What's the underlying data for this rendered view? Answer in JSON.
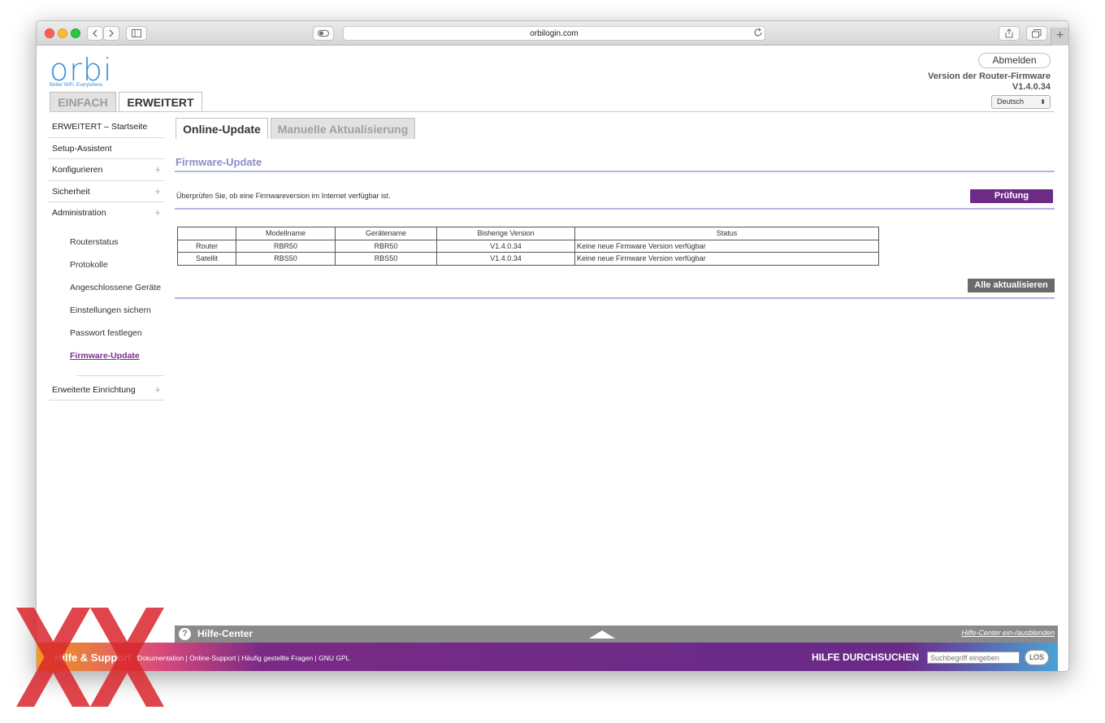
{
  "browser": {
    "url": "orbilogin.com"
  },
  "brand": {
    "logo": "orbi",
    "tagline": "Better WiFi. Everywhere."
  },
  "mode_tabs": {
    "simple": "EINFACH",
    "advanced": "ERWEITERT"
  },
  "header": {
    "logout": "Abmelden",
    "firmware_label": "Version der Router-Firmware",
    "firmware_version": "V1.4.0.34",
    "language": "Deutsch"
  },
  "sidebar": {
    "items": [
      {
        "label": "ERWEITERT – Startseite"
      },
      {
        "label": "Setup-Assistent"
      },
      {
        "label": "Konfigurieren",
        "expand": "+"
      },
      {
        "label": "Sicherheit",
        "expand": "+"
      },
      {
        "label": "Administration",
        "expand": "+"
      }
    ],
    "subitems": [
      {
        "label": "Routerstatus"
      },
      {
        "label": "Protokolle"
      },
      {
        "label": "Angeschlossene Geräte"
      },
      {
        "label": "Einstellungen sichern"
      },
      {
        "label": "Passwort festlegen"
      },
      {
        "label": "Firmware-Update"
      }
    ],
    "advanced_setup": {
      "label": "Erweiterte Einrichtung",
      "expand": "+"
    }
  },
  "content": {
    "tabs": [
      {
        "label": "Online-Update"
      },
      {
        "label": "Manuelle Aktualisierung"
      }
    ],
    "section_title": "Firmware-Update",
    "check_text": "Überprüfen Sie, ob eine Firmwareversion im Internet verfügbar ist.",
    "check_button": "Prüfung",
    "update_all_button": "Alle aktualisieren",
    "table": {
      "headers": [
        "",
        "Modellname",
        "Gerätename",
        "Bisherige Version",
        "Status"
      ],
      "rows": [
        [
          "Router",
          "RBR50",
          "RBR50",
          "V1.4.0.34",
          "Keine neue Firmware Version verfügbar"
        ],
        [
          "Satellit",
          "RBS50",
          "RBS50",
          "V1.4.0.34",
          "Keine neue Firmware Version verfügbar"
        ]
      ]
    }
  },
  "help": {
    "icon": "?",
    "title": "Hilfe-Center",
    "toggle": "Hilfe-Center ein-/ausblenden"
  },
  "support": {
    "title": "Hilfe & Support",
    "links": [
      "Dokumentation",
      "Online-Support",
      "Häufig gestellte Fragen",
      "GNU GPL"
    ],
    "link_sep": "|",
    "search_label": "HILFE DURCHSUCHEN",
    "search_placeholder": "Suchbegriff eingeben",
    "search_button": "LOS"
  },
  "colors": {
    "accent_purple": "#6e2b86",
    "title_lavender": "#8c8cc9",
    "logo_blue": "#3a8fd8",
    "watermark_red": "#d9262c"
  }
}
